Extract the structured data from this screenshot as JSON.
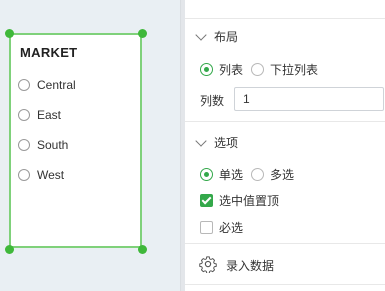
{
  "widget": {
    "title": "MARKET",
    "options": [
      "Central",
      "East",
      "South",
      "West"
    ]
  },
  "panel": {
    "layout": {
      "title": "布局",
      "mode_list": "列表",
      "mode_dropdown": "下拉列表",
      "columns_label": "列数",
      "columns_value": "1"
    },
    "options_section": {
      "title": "选项",
      "single": "单选",
      "multi": "多选",
      "pin_selected": "选中值置顶",
      "required": "必选"
    },
    "enter_data": "录入数据"
  },
  "colors": {
    "accent": "#33a84a",
    "selection_border": "#7fd17a",
    "canvas_bg": "#e9eff3"
  }
}
